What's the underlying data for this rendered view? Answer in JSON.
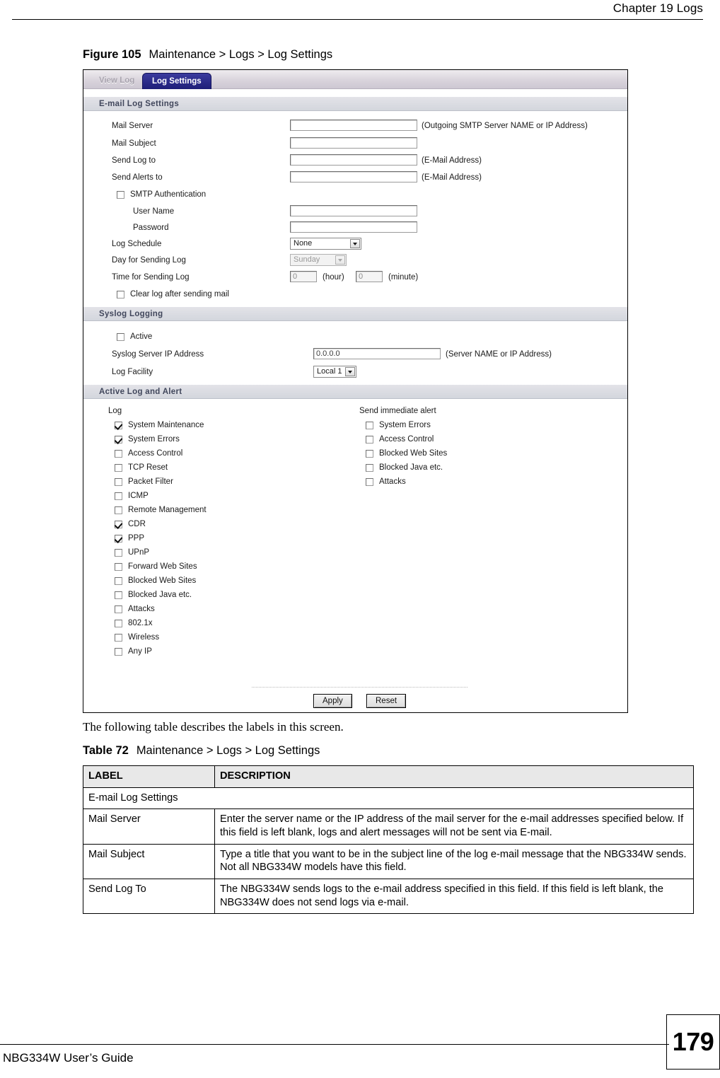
{
  "page": {
    "chapter_header": "Chapter 19 Logs",
    "footer_guide": "NBG334W User’s Guide",
    "page_number": "179",
    "paragraph": "The following table describes the labels in this screen."
  },
  "figure": {
    "number": "Figure 105",
    "title": "Maintenance > Logs > Log Settings"
  },
  "screenshot": {
    "tabs": [
      {
        "label": "View Log",
        "active": false
      },
      {
        "label": "Log Settings",
        "active": true
      }
    ],
    "email_section": {
      "heading": "E-mail Log Settings",
      "mail_server": {
        "label": "Mail Server",
        "value": "",
        "hint": "(Outgoing SMTP Server NAME or IP Address)"
      },
      "mail_subject": {
        "label": "Mail Subject",
        "value": "",
        "hint": ""
      },
      "send_log_to": {
        "label": "Send Log to",
        "value": "",
        "hint": "(E-Mail Address)"
      },
      "send_alerts_to": {
        "label": "Send Alerts to",
        "value": "",
        "hint": "(E-Mail Address)"
      },
      "smtp_auth": {
        "label": "SMTP Authentication",
        "checked": false
      },
      "user_name": {
        "label": "User Name",
        "value": ""
      },
      "password": {
        "label": "Password",
        "value": ""
      },
      "log_schedule": {
        "label": "Log Schedule",
        "value": "None",
        "disabled": false
      },
      "day_for_sending_log": {
        "label": "Day for Sending Log",
        "value": "Sunday",
        "disabled": true
      },
      "time_for_sending_log": {
        "label": "Time for Sending Log",
        "hour_value": "0",
        "hour_unit": "(hour)",
        "minute_value": "0",
        "minute_unit": "(minute)"
      },
      "clear_log": {
        "label": "Clear log after sending mail",
        "checked": false
      }
    },
    "syslog_section": {
      "heading": "Syslog Logging",
      "active": {
        "label": "Active",
        "checked": false
      },
      "server_ip": {
        "label": "Syslog Server IP Address",
        "value": "0.0.0.0",
        "hint": "(Server NAME or IP Address)"
      },
      "log_facility": {
        "label": "Log Facility",
        "value": "Local 1"
      }
    },
    "active_log_section": {
      "heading": "Active Log and Alert",
      "log_column_title": "Log",
      "alert_column_title": "Send immediate alert",
      "log_items": [
        {
          "label": "System Maintenance",
          "checked": true
        },
        {
          "label": "System Errors",
          "checked": true
        },
        {
          "label": "Access Control",
          "checked": false
        },
        {
          "label": "TCP Reset",
          "checked": false
        },
        {
          "label": "Packet Filter",
          "checked": false
        },
        {
          "label": "ICMP",
          "checked": false
        },
        {
          "label": "Remote Management",
          "checked": false
        },
        {
          "label": "CDR",
          "checked": true
        },
        {
          "label": "PPP",
          "checked": true
        },
        {
          "label": "UPnP",
          "checked": false
        },
        {
          "label": "Forward Web Sites",
          "checked": false
        },
        {
          "label": "Blocked Web Sites",
          "checked": false
        },
        {
          "label": "Blocked Java etc.",
          "checked": false
        },
        {
          "label": "Attacks",
          "checked": false
        },
        {
          "label": "802.1x",
          "checked": false
        },
        {
          "label": "Wireless",
          "checked": false
        },
        {
          "label": "Any IP",
          "checked": false
        }
      ],
      "alert_items": [
        {
          "label": "System Errors",
          "checked": false
        },
        {
          "label": "Access Control",
          "checked": false
        },
        {
          "label": "Blocked Web Sites",
          "checked": false
        },
        {
          "label": "Blocked Java etc.",
          "checked": false
        },
        {
          "label": "Attacks",
          "checked": false
        }
      ]
    },
    "buttons": {
      "apply": "Apply",
      "reset": "Reset"
    }
  },
  "table": {
    "number": "Table 72",
    "title": "Maintenance > Logs > Log Settings",
    "headers": [
      "LABEL",
      "DESCRIPTION"
    ],
    "rows": [
      {
        "type": "group",
        "label": "E-mail Log Settings"
      },
      {
        "type": "row",
        "label": "Mail Server",
        "description": "Enter the server name or the IP address of the mail server for the e-mail addresses specified below. If this field is left blank, logs and alert messages will not be sent via E-mail."
      },
      {
        "type": "row",
        "label": "Mail Subject",
        "description": "Type a title that you want to be in the subject line of the log e-mail message that the NBG334W sends. Not all NBG334W models have this field."
      },
      {
        "type": "row",
        "label": "Send Log To",
        "description": "The NBG334W sends logs to the e-mail address specified in this field. If this field is left blank, the NBG334W does not send logs via e-mail."
      }
    ]
  }
}
